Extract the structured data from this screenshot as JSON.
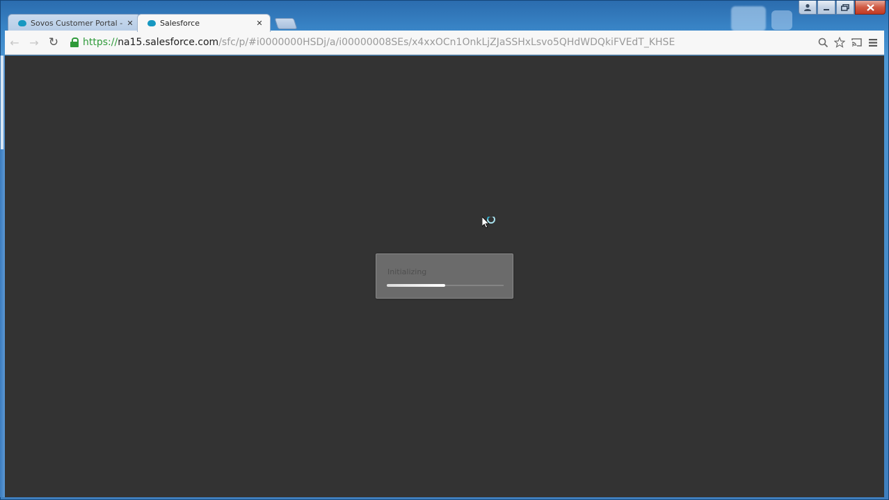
{
  "window": {
    "controls": [
      "user",
      "minimize",
      "maximize",
      "close"
    ]
  },
  "tabs": [
    {
      "title": "Sovos Customer Portal - F",
      "active": false,
      "close": "✕"
    },
    {
      "title": "Salesforce",
      "active": true,
      "close": "✕"
    }
  ],
  "toolbar": {
    "back_icon": "←",
    "forward_icon": "→",
    "reload_icon": "↻",
    "url_scheme": "https://",
    "url_host": "na15.salesforce.com",
    "url_path": "/sfc/p/#i0000000HSDj/a/i00000008SEs/x4xxOCn1OnkLjZJaSSHxLsvo5QHdWDQkiFVEdT_KHSE",
    "right_icons": [
      "zoom-icon",
      "star-icon",
      "cast-icon",
      "menu-icon"
    ]
  },
  "loader": {
    "text": "Initializing",
    "progress": 0.5
  },
  "colors": {
    "content_bg": "#333333",
    "tab_icon": "#1798c1",
    "secure": "#2f9a3a"
  }
}
